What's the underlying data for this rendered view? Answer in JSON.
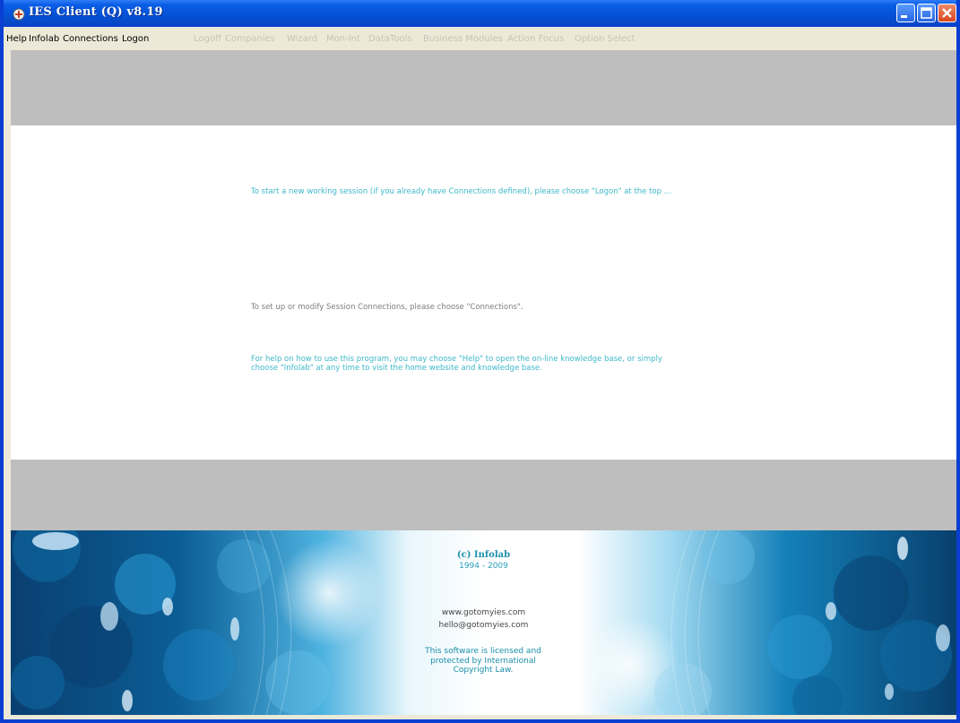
{
  "window": {
    "title": "IES Client (Q) v8.19",
    "icons": [
      "app-icon",
      "minimize-icon",
      "maximize-icon",
      "close-icon"
    ]
  },
  "menu": {
    "items": [
      {
        "label": "Help",
        "enabled": true
      },
      {
        "label": "Infolab",
        "enabled": true
      },
      {
        "label": "Connections",
        "enabled": true
      },
      {
        "label": "Logon",
        "enabled": true
      },
      {
        "label": "Logoff",
        "enabled": false
      },
      {
        "label": "Companies",
        "enabled": false
      },
      {
        "label": "Wizard",
        "enabled": false
      },
      {
        "label": "Mon-Int",
        "enabled": false
      },
      {
        "label": "DataTools",
        "enabled": false
      },
      {
        "label": "Business Modules",
        "enabled": false
      },
      {
        "label": "Action Focus",
        "enabled": false
      },
      {
        "label": "Option Select",
        "enabled": false
      }
    ]
  },
  "messages": {
    "start": "To start a new working session (if you already have Connections defined), please choose \"Logon\" at the top ...",
    "setup": "To set up or modify Session Connections, please choose \"Connections\".",
    "help": "For help on how to use this program, you may choose \"Help\" to open the on-line knowledge base, or simply choose \"Infolab\" at any time to visit the home website and knowledge base."
  },
  "footer": {
    "copyright": "(c) Infolab",
    "years": "1994 - 2009",
    "website": "www.gotomyies.com",
    "email": "hello@gotomyies.com",
    "license": "This software is licensed and protected by International Copyright Law."
  },
  "colors": {
    "titlebar": "#0a5ee6",
    "menu_bg": "#ece9d8",
    "panel_gray": "#bebebe",
    "message_accent": "#3fb8c9",
    "footer_blue": "#0b5e96"
  }
}
